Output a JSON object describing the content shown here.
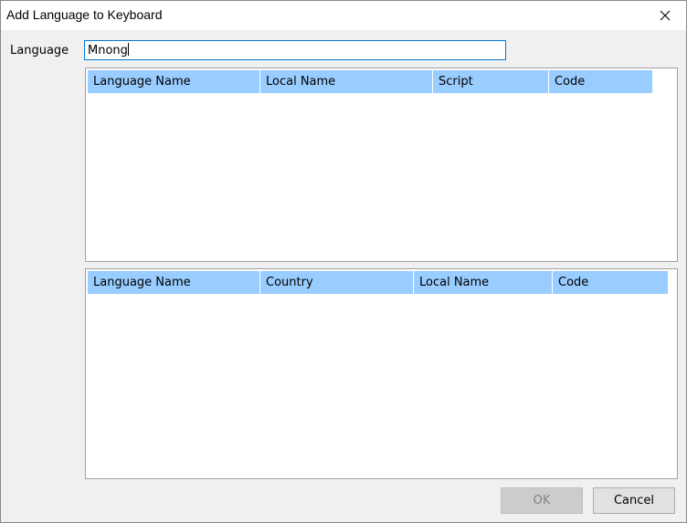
{
  "window": {
    "title": "Add Language to Keyboard"
  },
  "form": {
    "language_label": "Language",
    "language_value": "Mnong"
  },
  "grid_top": {
    "columns": [
      "Language Name",
      "Local Name",
      "Script",
      "Code"
    ],
    "rows": []
  },
  "grid_bottom": {
    "columns": [
      "Language Name",
      "Country",
      "Local Name",
      "Code"
    ],
    "rows": []
  },
  "buttons": {
    "ok_label": "OK",
    "cancel_label": "Cancel",
    "ok_enabled": false
  },
  "colors": {
    "header_bg": "#99ccff",
    "input_border": "#0078d7",
    "dialog_bg": "#f0f0f0"
  },
  "icons": {
    "close": "close-icon"
  }
}
